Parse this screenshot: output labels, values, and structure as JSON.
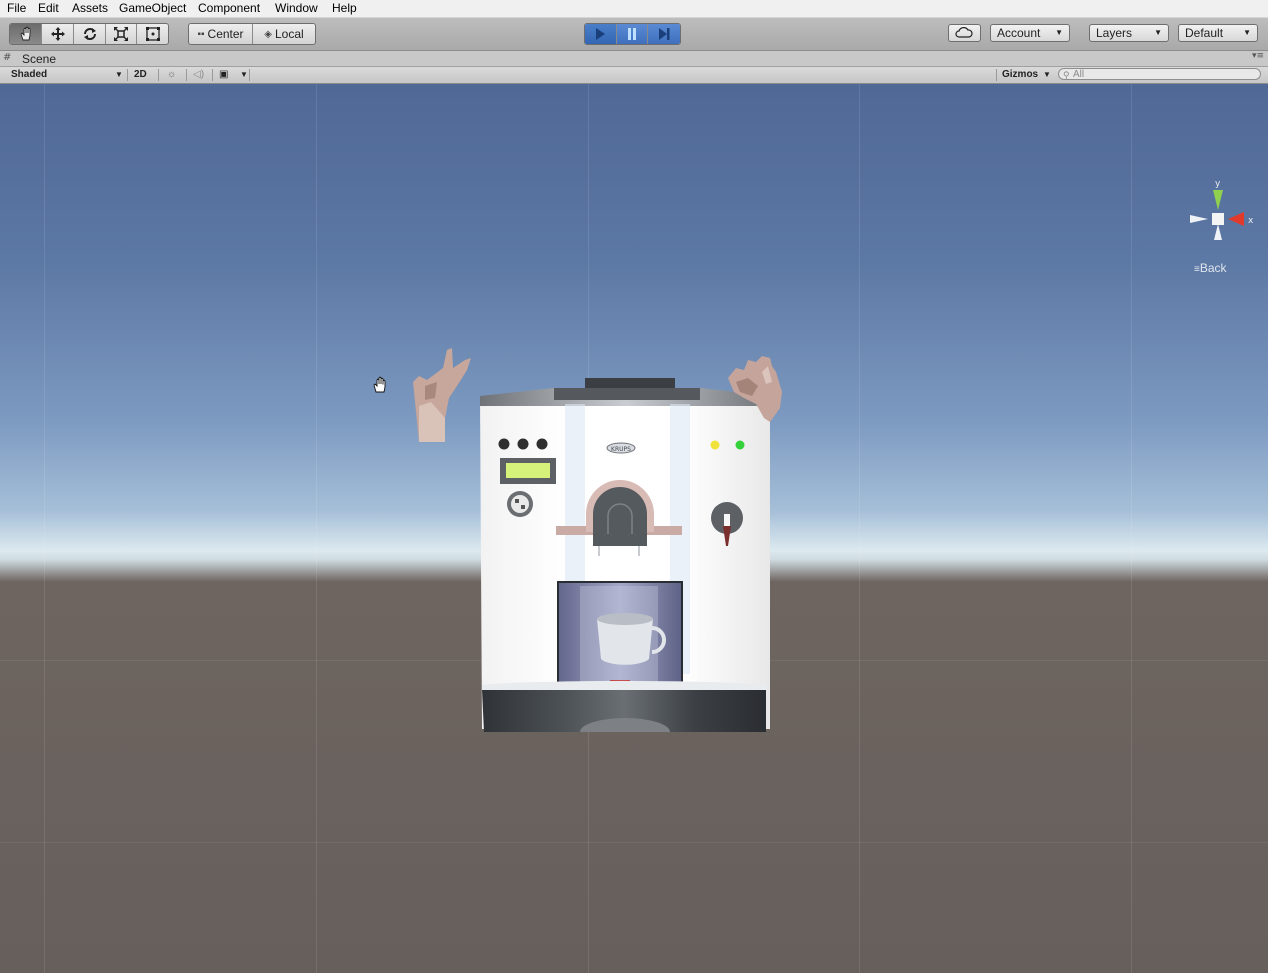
{
  "menu": [
    "File",
    "Edit",
    "Assets",
    "GameObject",
    "Component",
    "Window",
    "Help"
  ],
  "toolbar": {
    "tools": [
      "hand-tool",
      "move-tool",
      "rotate-tool",
      "scale-tool",
      "rect-tool"
    ],
    "pivot_center": "Center",
    "pivot_local": "Local",
    "account": "Account",
    "layers": "Layers",
    "layout": "Default"
  },
  "scene": {
    "tab_label": "Scene",
    "draw_mode": "Shaded",
    "mode_2d": "2D",
    "gizmos": "Gizmos",
    "search_placeholder": "All",
    "view_label": "Back",
    "axis_y": "y",
    "axis_x": "x"
  },
  "colors": {
    "play_active": "#3f70bd",
    "sky_top": "#506896",
    "ground": "#665f5c",
    "axis_y": "#8fd14f",
    "axis_x": "#e13a2a"
  },
  "machine": {
    "logo": "KRUPS"
  }
}
